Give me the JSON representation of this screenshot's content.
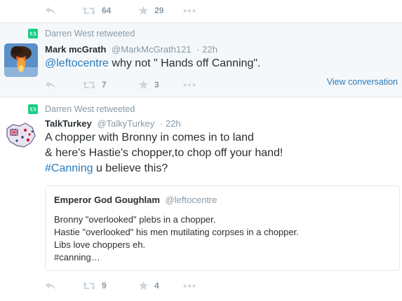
{
  "tweets": [
    {
      "actions": {
        "retweets": "64",
        "favorites": "29"
      }
    },
    {
      "retweeted_by": "Darren West retweeted",
      "fullname": "Mark mcGrath",
      "handle": "@MarkMcGrath121",
      "time": "· 22h",
      "mention": "@leftocentre",
      "text": " why not \" Hands off Canning\".",
      "view_conversation": "View conversation",
      "actions": {
        "retweets": "7",
        "favorites": "3"
      }
    },
    {
      "retweeted_by": "Darren West retweeted",
      "fullname": "TalkTurkey",
      "handle": "@TalkyTurkey",
      "time": "· 22h",
      "line1": "A chopper with Bronny in comes in to land",
      "line2": "& here's Hastie's chopper,to chop off your hand!",
      "hashtag": "#Canning",
      "line3_rest": " u believe this?",
      "quote": {
        "fullname": "Emperor God Goughlam",
        "handle": "@leftocentre",
        "lines": [
          "Bronny \"overlooked\" plebs in a chopper.",
          "Hastie \"overlooked\" his men mutilating corpses in a chopper.",
          "Libs love choppers eh.",
          "#canning…"
        ]
      },
      "actions": {
        "retweets": "9",
        "favorites": "4"
      }
    }
  ],
  "icons": {
    "reply": "reply-icon",
    "retweet": "retweet-icon",
    "favorite": "star-icon",
    "more": "more-icon",
    "retweet_badge": "retweet-badge-icon",
    "avatar_mark": "avatar-explosion-image",
    "avatar_talk": "avatar-flag-image"
  },
  "colors": {
    "link": "#2b7bb9",
    "muted": "#8899a6",
    "retweet_green": "#19cf86",
    "highlight_bg": "#f5f8fa",
    "border": "#e1e8ed"
  }
}
